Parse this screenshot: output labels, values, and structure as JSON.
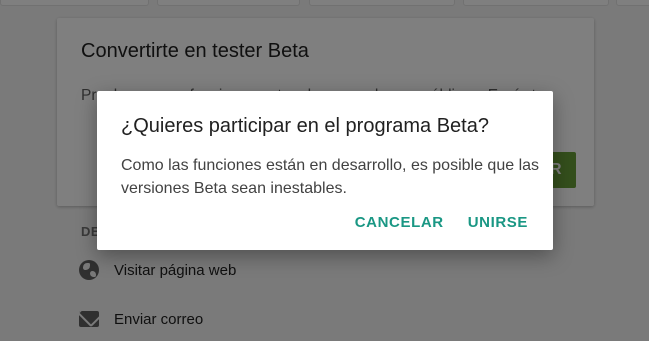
{
  "beta_card": {
    "title": "Convertirte en tester Beta",
    "description": "Prueba nuevas funciones antes de que se hagan públicas. Envía tus",
    "button_label": "R"
  },
  "section": {
    "title": "DE"
  },
  "list": {
    "items": [
      {
        "icon": "globe-icon",
        "label": "Visitar página web"
      },
      {
        "icon": "email-icon",
        "label": "Enviar correo"
      }
    ]
  },
  "dialog": {
    "title": "¿Quieres participar en el programa Beta?",
    "body": "Como las funciones están en desarrollo, es posible que las versiones Beta sean inestables.",
    "cancel_label": "CANCELAR",
    "join_label": "UNIRSE"
  },
  "colors": {
    "accent": "#1a9784",
    "beta_button": "#689f38",
    "scrim": "rgba(0,0,0,0.50)"
  }
}
